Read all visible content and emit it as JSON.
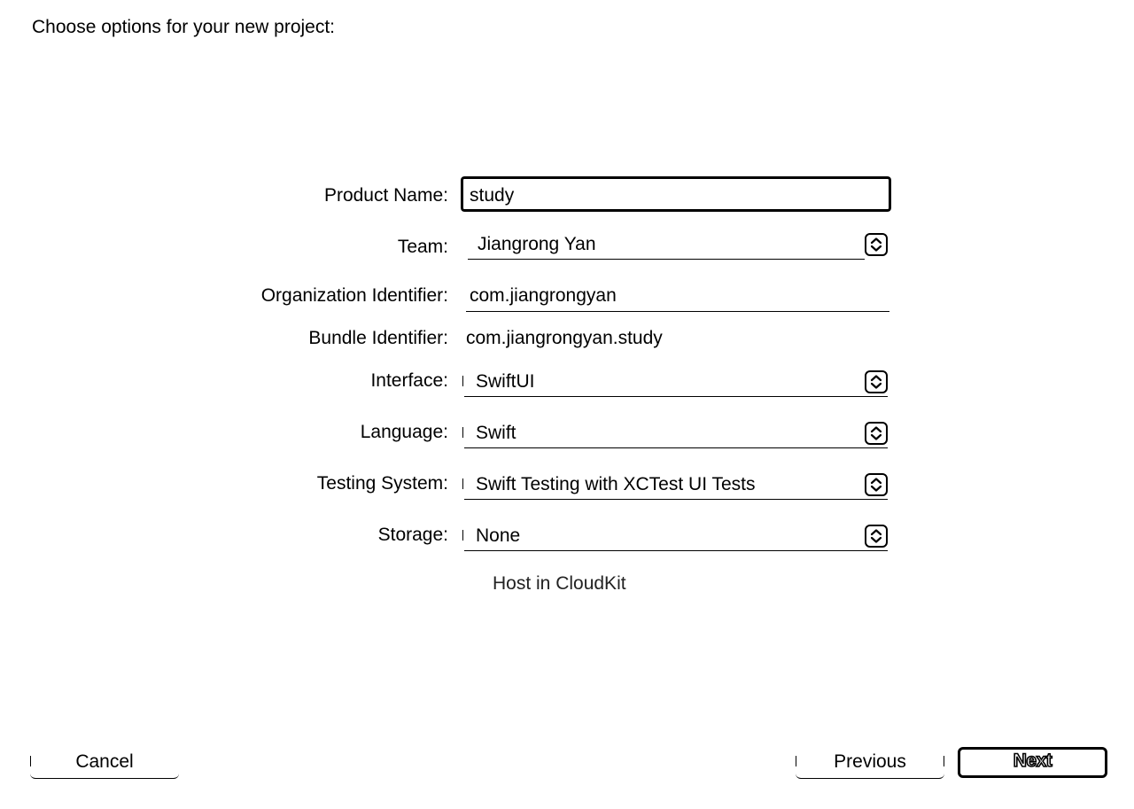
{
  "dialog": {
    "heading": "Choose options for your new project:"
  },
  "form": {
    "product_name": {
      "label": "Product Name:",
      "value": "study"
    },
    "team": {
      "label": "Team:",
      "value": "Jiangrong Yan"
    },
    "organization_identifier": {
      "label": "Organization Identifier:",
      "value": "com.jiangrongyan"
    },
    "bundle_identifier": {
      "label": "Bundle Identifier:",
      "value": "com.jiangrongyan.study"
    },
    "interface": {
      "label": "Interface:",
      "value": "SwiftUI"
    },
    "language": {
      "label": "Language:",
      "value": "Swift"
    },
    "testing_system": {
      "label": "Testing System:",
      "value": "Swift Testing with XCTest UI Tests"
    },
    "storage": {
      "label": "Storage:",
      "value": "None"
    },
    "host_in_cloudkit": {
      "label": "Host in CloudKit",
      "checked": false
    }
  },
  "buttons": {
    "cancel": "Cancel",
    "previous": "Previous",
    "next": "Next"
  },
  "icons": {
    "popup_stepper": "up-down-chevron-icon"
  }
}
